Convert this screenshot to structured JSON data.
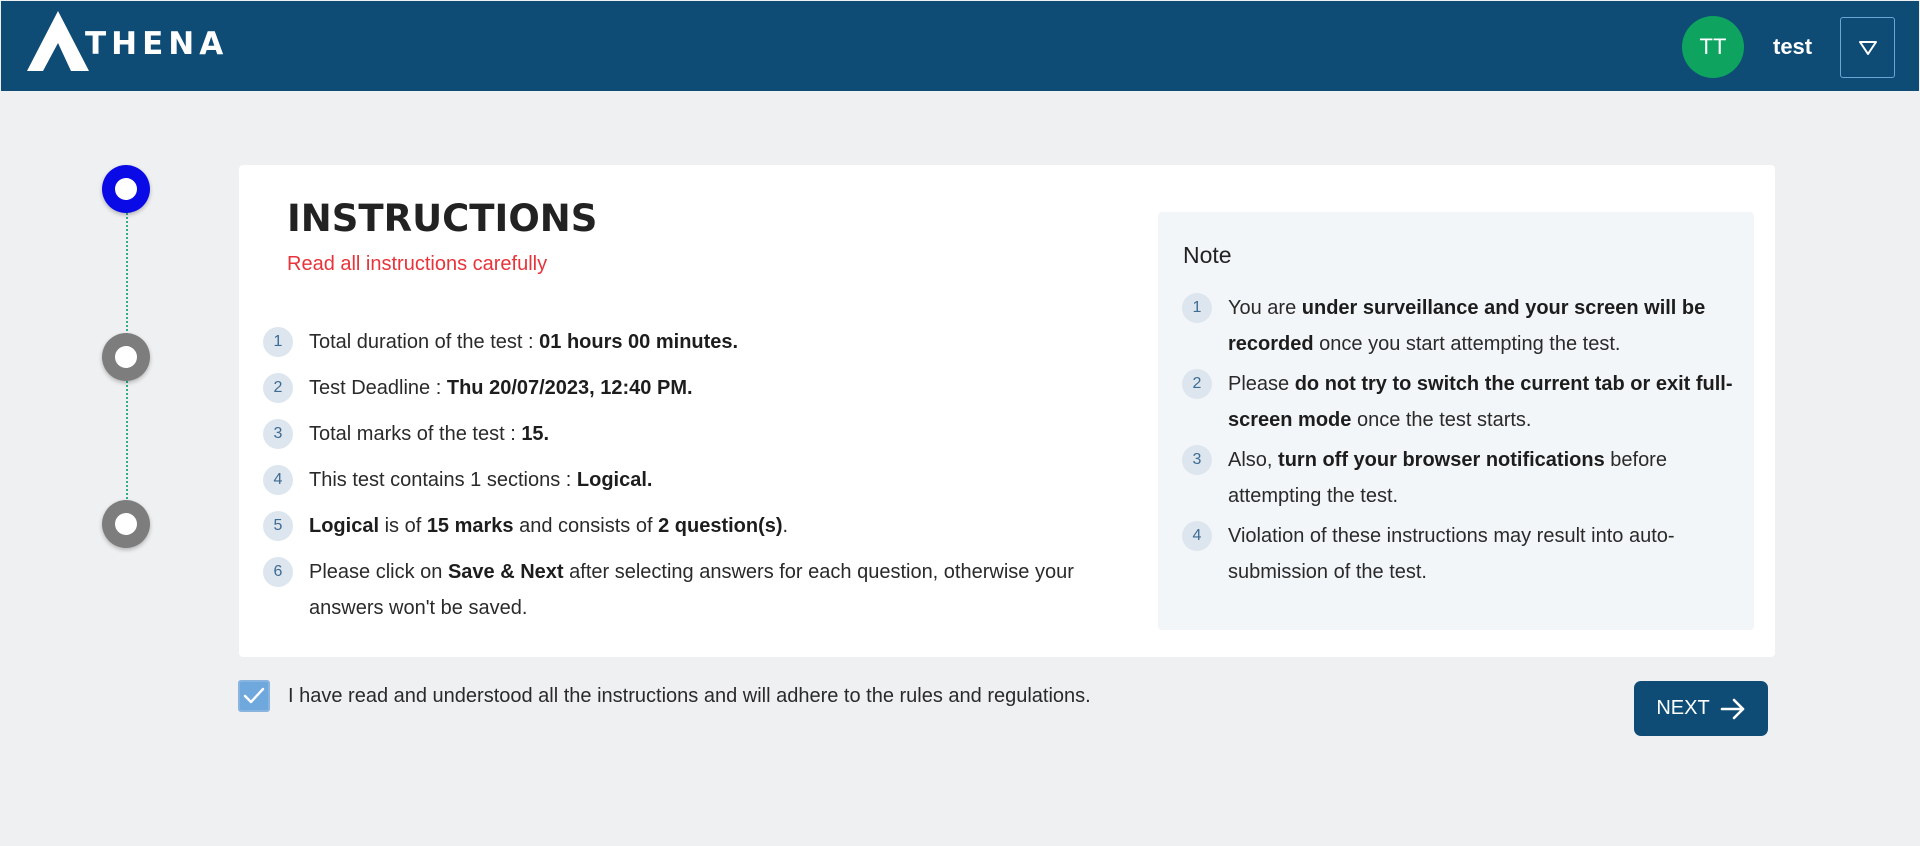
{
  "header": {
    "logo_text": "THENA",
    "avatar_initials": "TT",
    "username": "test",
    "colors": {
      "bar": "#0e4c76",
      "avatar": "#0ea35f"
    }
  },
  "stepper": {
    "steps": [
      {
        "state": "active"
      },
      {
        "state": "inactive"
      },
      {
        "state": "inactive"
      }
    ]
  },
  "instructions": {
    "title": "INSTRUCTIONS",
    "subtitle": "Read all instructions carefully",
    "items": [
      {
        "num": "1",
        "parts": [
          {
            "t": "Total duration of the test : "
          },
          {
            "t": "01 hours 00 minutes.",
            "b": true
          }
        ]
      },
      {
        "num": "2",
        "parts": [
          {
            "t": "Test Deadline : "
          },
          {
            "t": "Thu 20/07/2023, 12:40 PM.",
            "b": true
          }
        ]
      },
      {
        "num": "3",
        "parts": [
          {
            "t": "Total marks of the test : "
          },
          {
            "t": "15.",
            "b": true
          }
        ]
      },
      {
        "num": "4",
        "parts": [
          {
            "t": "This test contains 1 sections : "
          },
          {
            "t": "Logical.",
            "b": true
          }
        ]
      },
      {
        "num": "5",
        "parts": [
          {
            "t": "Logical",
            "b": true
          },
          {
            "t": " is of "
          },
          {
            "t": "15 marks",
            "b": true
          },
          {
            "t": " and consists of "
          },
          {
            "t": "2 question(s)",
            "b": true
          },
          {
            "t": "."
          }
        ]
      },
      {
        "num": "6",
        "parts": [
          {
            "t": "Please click on "
          },
          {
            "t": "Save & Next",
            "b": true
          },
          {
            "t": " after selecting answers for each question, otherwise your answers won't be saved."
          }
        ]
      }
    ]
  },
  "note": {
    "title": "Note",
    "items": [
      {
        "num": "1",
        "parts": [
          {
            "t": "You are "
          },
          {
            "t": "under surveillance and your screen will be recorded",
            "b": true
          },
          {
            "t": " once you start attempting the test."
          }
        ]
      },
      {
        "num": "2",
        "parts": [
          {
            "t": "Please "
          },
          {
            "t": "do not try to switch the current tab or exit full-screen mode",
            "b": true
          },
          {
            "t": " once the test starts."
          }
        ]
      },
      {
        "num": "3",
        "parts": [
          {
            "t": "Also, "
          },
          {
            "t": "turn off your browser notifications",
            "b": true
          },
          {
            "t": " before attempting the test."
          }
        ]
      },
      {
        "num": "4",
        "parts": [
          {
            "t": "Violation of these instructions may result into auto-submission of the test."
          }
        ]
      }
    ]
  },
  "agreement": {
    "checked": true,
    "label": "I have read and understood all the instructions and will adhere to the rules and regulations."
  },
  "next_button": {
    "label": "NEXT",
    "icon": "arrow-right-icon"
  }
}
